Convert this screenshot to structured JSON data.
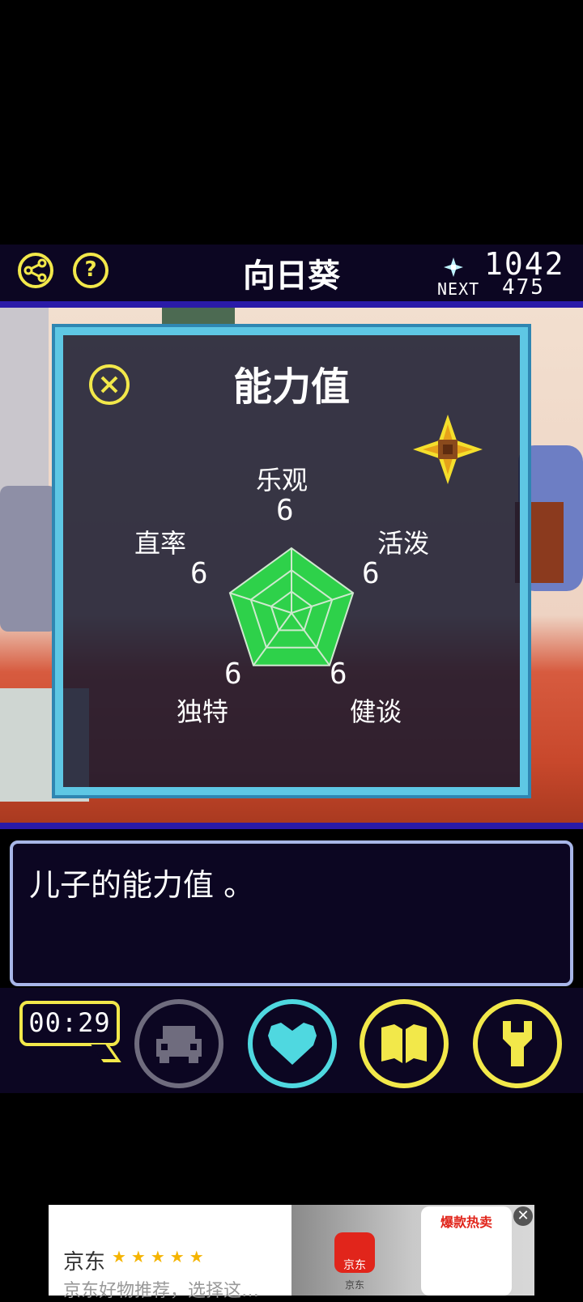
{
  "header": {
    "title": "向日葵",
    "score": "1042",
    "next_label": "NEXT",
    "next_value": "475",
    "help_glyph": "?"
  },
  "panel": {
    "title": "能力值",
    "stats": [
      {
        "name": "乐观",
        "value": "6"
      },
      {
        "name": "活泼",
        "value": "6"
      },
      {
        "name": "健谈",
        "value": "6"
      },
      {
        "name": "独特",
        "value": "6"
      },
      {
        "name": "直率",
        "value": "6"
      }
    ],
    "radar_max": 10,
    "radar_color": "#2ed14a"
  },
  "dialog": {
    "text": "儿子的能力值 。"
  },
  "bottom": {
    "timer": "00:29"
  },
  "ad": {
    "brand": "京东",
    "stars": "★★★★★",
    "description": "京东好物推荐，选择这…",
    "logo_text": "京东",
    "logo_label": "京东",
    "hot_label": "爆款热卖",
    "close_glyph": "✕"
  },
  "colors": {
    "accent_yellow": "#f2e84a",
    "accent_cyan": "#4fd8e0",
    "panel_border": "#5ec7e4",
    "header_bg": "#0c0622"
  }
}
